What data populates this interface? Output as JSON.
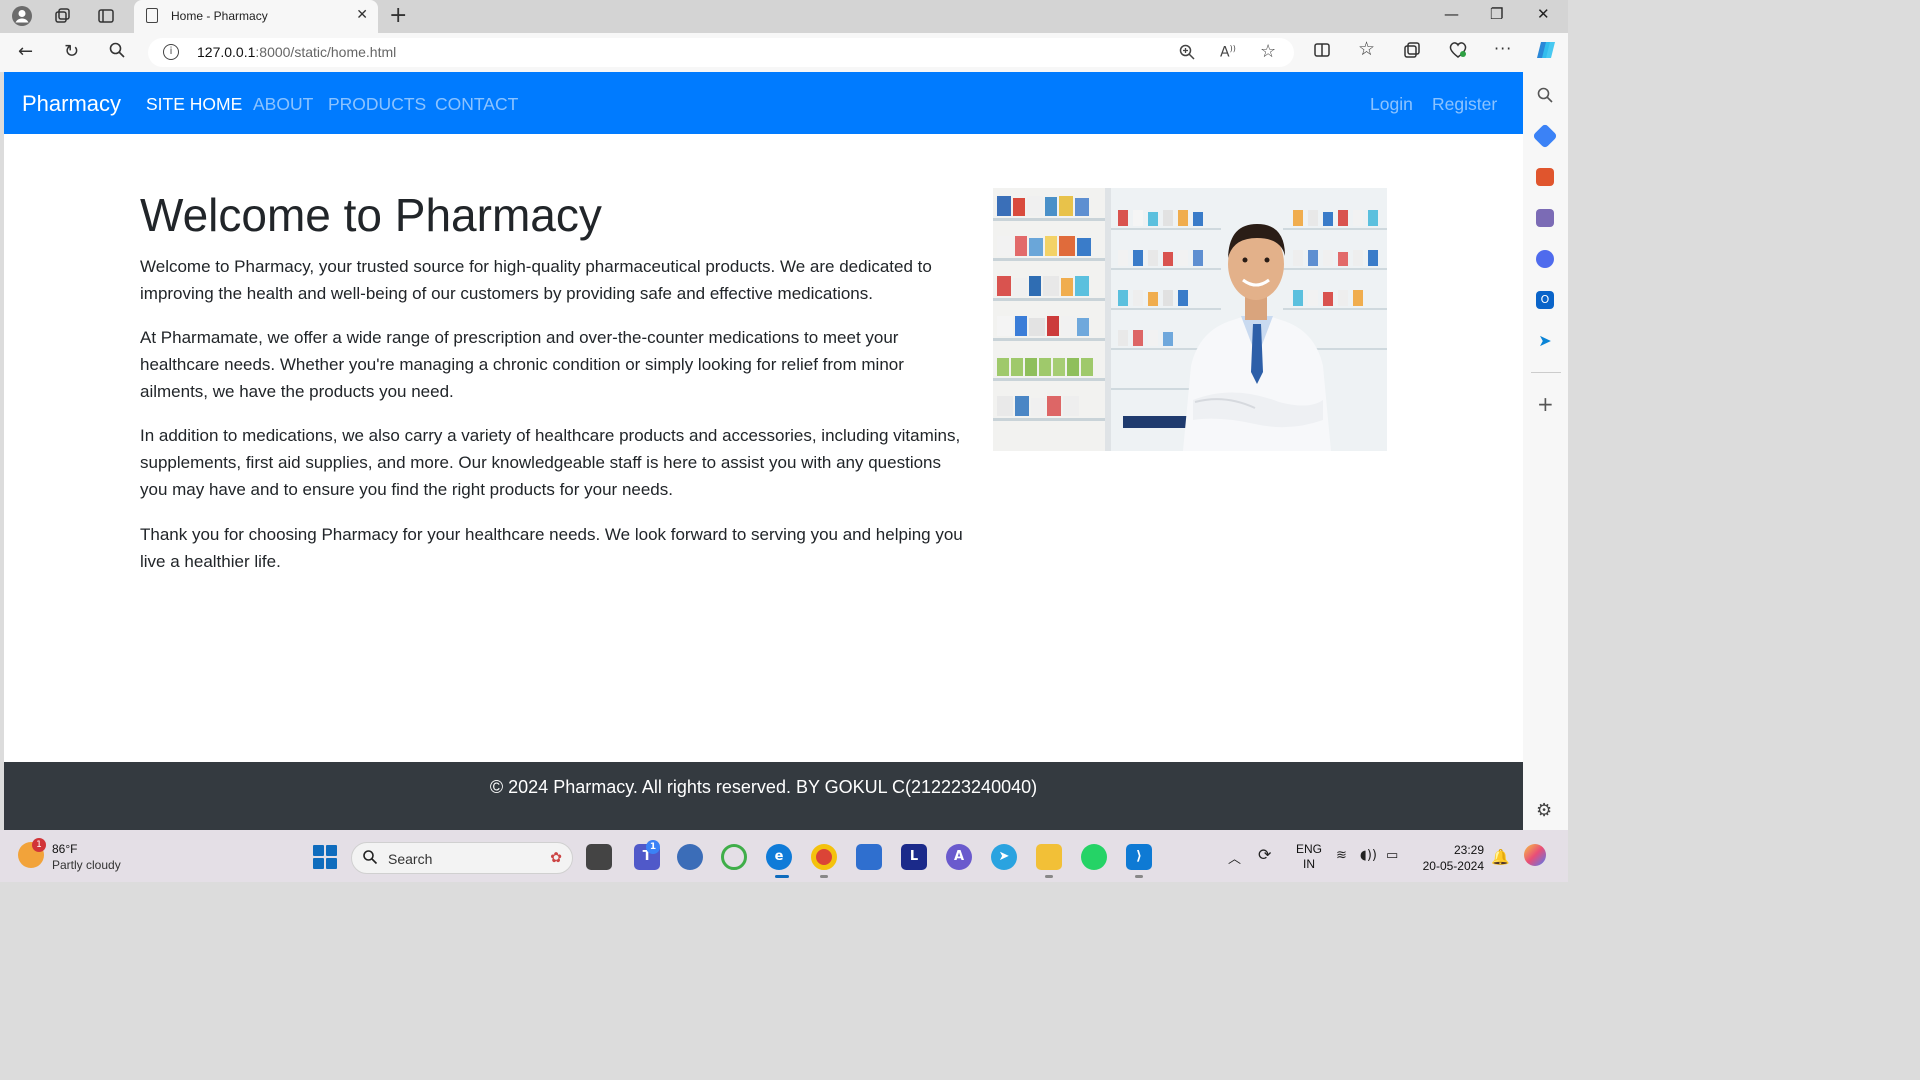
{
  "browser": {
    "tab_title": "Home - Pharmacy",
    "url_host": "127.0.0.1",
    "url_path": ":8000/static/home.html"
  },
  "navbar": {
    "brand": "Pharmacy",
    "links": [
      "SITE HOME",
      "ABOUT",
      "PRODUCTS",
      "CONTACT"
    ],
    "active_link": "SITE HOME",
    "auth": [
      "Login",
      "Register"
    ],
    "color": "#007bff"
  },
  "main": {
    "title": "Welcome to Pharmacy",
    "paragraphs": [
      "Welcome to Pharmacy, your trusted source for high-quality pharmaceutical products. We are dedicated to improving the health and well-being of our customers by providing safe and effective medications.",
      "At Pharmamate, we offer a wide range of prescription and over-the-counter medications to meet your healthcare needs. Whether you're managing a chronic condition or simply looking for relief from minor ailments, we have the products you need.",
      "In addition to medications, we also carry a variety of healthcare products and accessories, including vitamins, supplements, first aid supplies, and more. Our knowledgeable staff is here to assist you with any questions you may have and to ensure you find the right products for your needs.",
      "Thank you for choosing Pharmacy for your healthcare needs. We look forward to serving you and helping you live a healthier life."
    ]
  },
  "footer": {
    "text": "© 2024 Pharmacy. All rights reserved. BY GOKUL C(212223240040)",
    "color": "#343a40"
  },
  "taskbar": {
    "weather_temp": "86°F",
    "weather_condition": "Partly cloudy",
    "weather_badge": "1",
    "search_placeholder": "Search",
    "teams_badge": "1",
    "lang_line1": "ENG",
    "lang_line2": "IN",
    "time": "23:29",
    "date": "20-05-2024"
  }
}
